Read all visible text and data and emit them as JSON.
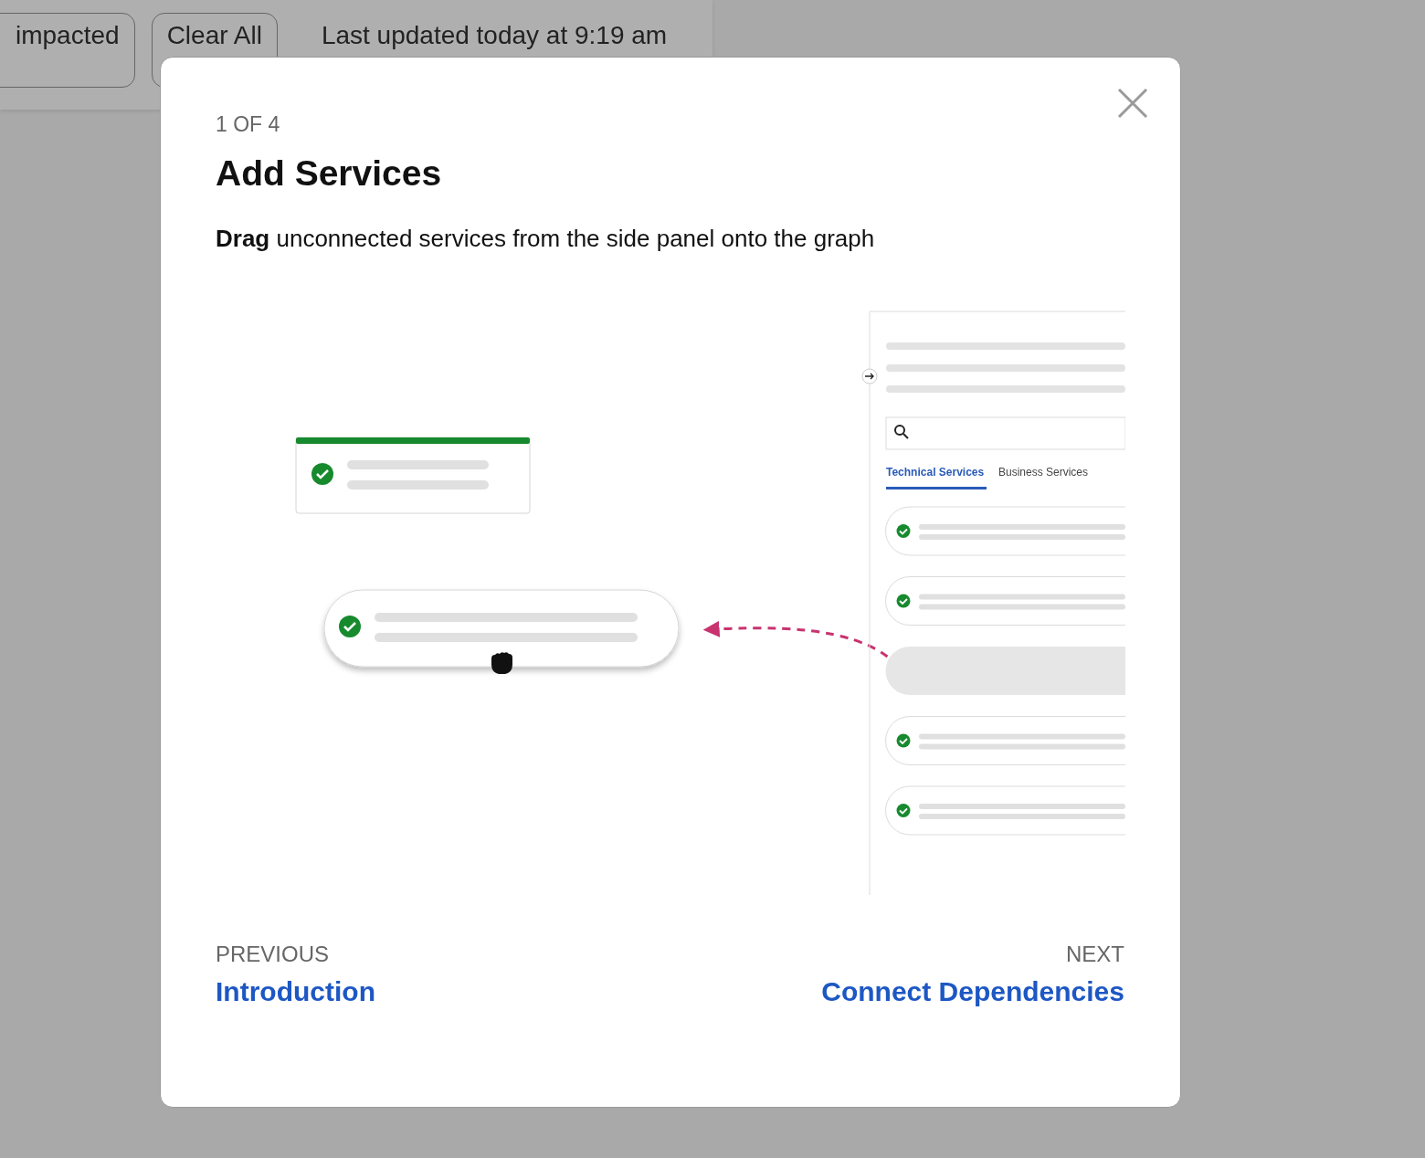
{
  "toolbar": {
    "buttons": [
      "impacted",
      "Clear All"
    ],
    "last_updated": "Last updated today at 9:19 am"
  },
  "modal": {
    "step": "1 OF 4",
    "title": "Add Services",
    "description": "**Drag** unconnected services from the side panel onto the graph",
    "illustration": {
      "tabs": [
        {
          "label": "Technical Services",
          "selected": true
        },
        {
          "label": "Business Services",
          "selected": false
        }
      ],
      "list": [
        {
          "kind": "service"
        },
        {
          "kind": "service"
        },
        {
          "kind": "empty"
        },
        {
          "kind": "service"
        },
        {
          "kind": "service"
        }
      ]
    },
    "previous": {
      "label": "PREVIOUS",
      "title": "Introduction"
    },
    "next": {
      "label": "NEXT",
      "title": "Connect Dependencies"
    }
  }
}
